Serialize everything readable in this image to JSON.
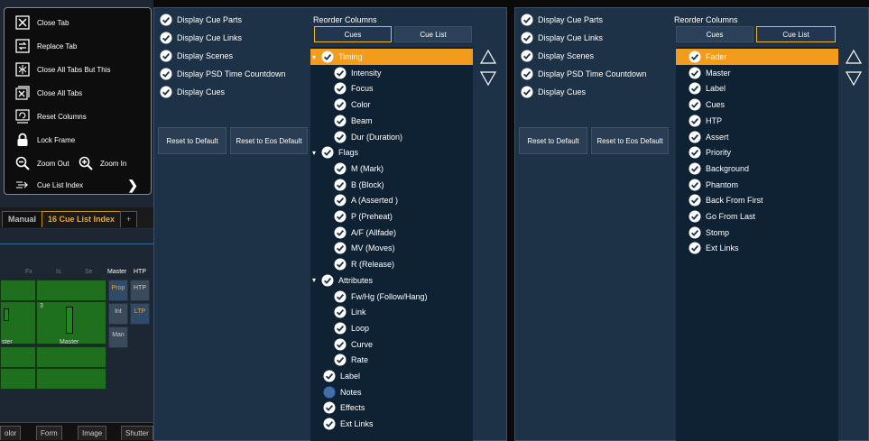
{
  "colors": {
    "panel_bg": "#1d3247",
    "list_bg": "#0f2233",
    "highlight": "#f29b1c",
    "active_tab": "#f5a623"
  },
  "background_app": {
    "tabs": [
      {
        "label": "Manual",
        "active": false
      },
      {
        "label": "16 Cue List Index",
        "active": true
      },
      {
        "label": "+",
        "active": false
      }
    ],
    "column_heads": [
      "Fx",
      "Is",
      "Se",
      "Master",
      "HTP"
    ],
    "side_buttons": [
      {
        "label": "Prop",
        "active": true
      },
      {
        "label": "HTP",
        "active": false
      },
      {
        "label": "Int",
        "active": false
      },
      {
        "label": "LTP",
        "active": true
      },
      {
        "label": "Man",
        "active": false
      }
    ],
    "fader_number": "3",
    "fader_labels": [
      "ster",
      "Master"
    ],
    "bottom_tabs": [
      "olor",
      "Form",
      "Image",
      "Shutter"
    ]
  },
  "context_menu": {
    "items": [
      {
        "label": "Close Tab",
        "icon": "close-tab-icon"
      },
      {
        "label": "Replace Tab",
        "icon": "replace-tab-icon"
      },
      {
        "label": "Close All Tabs But This",
        "icon": "close-others-icon"
      },
      {
        "label": "Close All Tabs",
        "icon": "close-all-icon"
      },
      {
        "label": "Reset Columns",
        "icon": "reset-columns-icon"
      },
      {
        "label": "Lock Frame",
        "icon": "lock-icon"
      },
      {
        "label": "Zoom Out",
        "icon": "zoom-out-icon"
      },
      {
        "label": "Zoom In",
        "icon": "zoom-in-icon"
      },
      {
        "label": "Cue List Index",
        "icon": "cue-list-index-icon"
      }
    ]
  },
  "panel_cues": {
    "options": [
      {
        "label": "Display Cue Parts",
        "checked": true
      },
      {
        "label": "Display Cue Links",
        "checked": true
      },
      {
        "label": "Display Scenes",
        "checked": true
      },
      {
        "label": "Display PSD Time Countdown",
        "checked": true
      },
      {
        "label": "Display Cues",
        "checked": true
      }
    ],
    "reset_default": "Reset to Default",
    "reset_eos": "Reset to Eos Default",
    "reorder_title": "Reorder Columns",
    "seg_cues": "Cues",
    "seg_cuelist": "Cue List",
    "active_seg": "cues",
    "columns": [
      {
        "label": "Timing",
        "level": 0,
        "checked": true,
        "group": true,
        "highlight": true
      },
      {
        "label": "Intensity",
        "level": 1,
        "checked": true
      },
      {
        "label": "Focus",
        "level": 1,
        "checked": true
      },
      {
        "label": "Color",
        "level": 1,
        "checked": true
      },
      {
        "label": "Beam",
        "level": 1,
        "checked": true
      },
      {
        "label": "Dur (Duration)",
        "level": 1,
        "checked": true
      },
      {
        "label": "Flags",
        "level": 0,
        "checked": true,
        "group": true
      },
      {
        "label": "M (Mark)",
        "level": 1,
        "checked": true
      },
      {
        "label": "B (Block)",
        "level": 1,
        "checked": true
      },
      {
        "label": "A (Asserted )",
        "level": 1,
        "checked": true
      },
      {
        "label": "P (Preheat)",
        "level": 1,
        "checked": true
      },
      {
        "label": "A/F (Allfade)",
        "level": 1,
        "checked": true
      },
      {
        "label": "MV (Moves)",
        "level": 1,
        "checked": true
      },
      {
        "label": "R (Release)",
        "level": 1,
        "checked": true
      },
      {
        "label": "Attributes",
        "level": 0,
        "checked": true,
        "group": true
      },
      {
        "label": "Fw/Hg (Follow/Hang)",
        "level": 1,
        "checked": true
      },
      {
        "label": "Link",
        "level": 1,
        "checked": true
      },
      {
        "label": "Loop",
        "level": 1,
        "checked": true
      },
      {
        "label": "Curve",
        "level": 1,
        "checked": true
      },
      {
        "label": "Rate",
        "level": 1,
        "checked": true
      },
      {
        "label": "Label",
        "level": 0,
        "checked": true
      },
      {
        "label": "Notes",
        "level": 0,
        "checked": false
      },
      {
        "label": "Effects",
        "level": 0,
        "checked": true
      },
      {
        "label": "Ext Links",
        "level": 0,
        "checked": true
      }
    ]
  },
  "panel_cuelist": {
    "options": [
      {
        "label": "Display Cue Parts",
        "checked": true
      },
      {
        "label": "Display Cue Links",
        "checked": true
      },
      {
        "label": "Display Scenes",
        "checked": true
      },
      {
        "label": "Display PSD Time Countdown",
        "checked": true
      },
      {
        "label": "Display Cues",
        "checked": true
      }
    ],
    "reset_default": "Reset to Default",
    "reset_eos": "Reset to Eos Default",
    "reorder_title": "Reorder Columns",
    "seg_cues": "Cues",
    "seg_cuelist": "Cue List",
    "active_seg": "cuelist",
    "columns": [
      {
        "label": "Fader",
        "level": 0,
        "checked": true,
        "highlight": true
      },
      {
        "label": "Master",
        "level": 0,
        "checked": true
      },
      {
        "label": "Label",
        "level": 0,
        "checked": true
      },
      {
        "label": "Cues",
        "level": 0,
        "checked": true
      },
      {
        "label": "HTP",
        "level": 0,
        "checked": true
      },
      {
        "label": "Assert",
        "level": 0,
        "checked": true
      },
      {
        "label": "Priority",
        "level": 0,
        "checked": true
      },
      {
        "label": "Background",
        "level": 0,
        "checked": true
      },
      {
        "label": "Phantom",
        "level": 0,
        "checked": true
      },
      {
        "label": "Back From First",
        "level": 0,
        "checked": true
      },
      {
        "label": "Go From Last",
        "level": 0,
        "checked": true
      },
      {
        "label": "Stomp",
        "level": 0,
        "checked": true
      },
      {
        "label": "Ext Links",
        "level": 0,
        "checked": true
      }
    ]
  }
}
